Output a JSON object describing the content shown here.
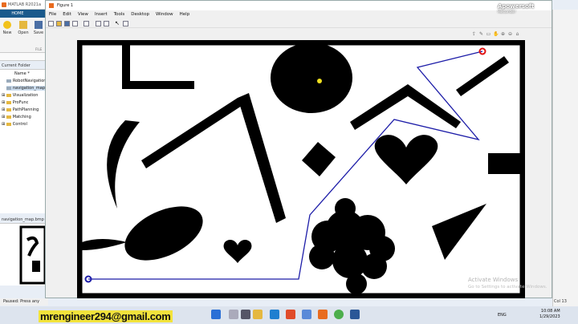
{
  "matlab": {
    "title": "MATLAB R2021a",
    "home_tab": "HOME",
    "ribbon": [
      "New",
      "Open",
      "Save"
    ],
    "ribbon_section": "FILE",
    "current_folder_label": "Current Folder",
    "name_header": "Name *",
    "files": [
      {
        "name": "RobotNavigation",
        "type": "file"
      },
      {
        "name": "navigation_map.bmp",
        "type": "file"
      },
      {
        "name": "Visualization",
        "type": "folder"
      },
      {
        "name": "ProFunc",
        "type": "folder"
      },
      {
        "name": "PathPlanning",
        "type": "folder"
      },
      {
        "name": "Matching",
        "type": "folder"
      },
      {
        "name": "Control",
        "type": "folder"
      }
    ],
    "preview_label": "navigation_map.bmp",
    "status": "Paused: Press any",
    "cursor_pos": "Col 13"
  },
  "figure": {
    "title": "Figure 1",
    "menu": [
      "File",
      "Edit",
      "View",
      "Insert",
      "Tools",
      "Desktop",
      "Window",
      "Help"
    ]
  },
  "overlay": {
    "email": "mrengineer294@gmail.com",
    "activate_title": "Activate Windows",
    "activate_sub": "Go to Settings to activate Windows.",
    "apowersoft": "Apowersoft",
    "apowersoft_sub": "Recorder"
  },
  "taskbar": {
    "lang": "ENG",
    "time": "10:08 AM",
    "date": "1/29/2023"
  },
  "colors": {
    "path": "#1c1ca8",
    "start_marker": "#1c1ca8",
    "goal_marker": "#e01010",
    "robot": "#f0e020"
  }
}
